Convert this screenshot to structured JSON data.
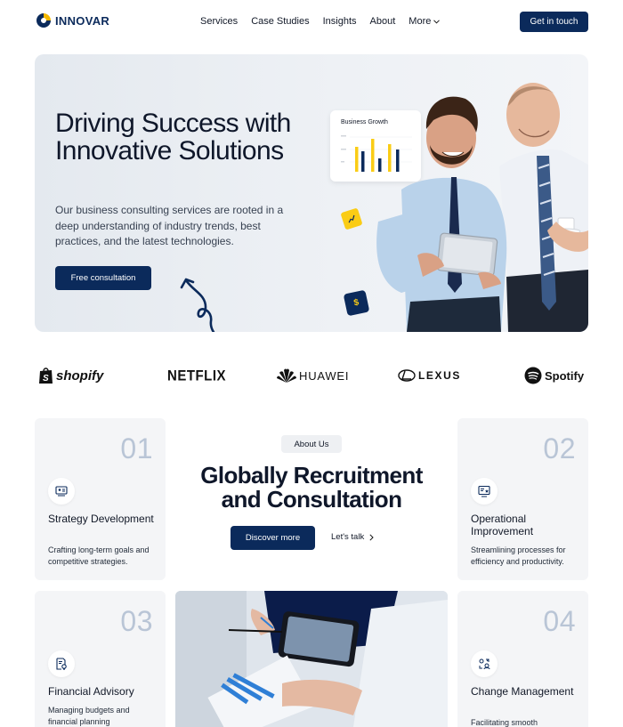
{
  "brand": {
    "name": "INNOVAR"
  },
  "nav": {
    "links": [
      "Services",
      "Case Studies",
      "Insights",
      "About",
      "More"
    ],
    "cta": "Get in touch"
  },
  "hero": {
    "title": "Driving Success with Innovative Solutions",
    "subtitle": "Our business consulting services are rooted in a deep understanding of industry trends, best practices, and the latest technologies.",
    "button": "Free consultation",
    "card_title": "Business Growth",
    "chip_symbol": "$"
  },
  "partners": [
    "shopify",
    "NETFLIX",
    "HUAWEI",
    "LEXUS",
    "Spotify"
  ],
  "about": {
    "pill": "About Us",
    "title": "Globally Recruitment and Consultation",
    "primary_button": "Discover more",
    "secondary_link": "Let's talk"
  },
  "services": [
    {
      "num": "01",
      "title": "Strategy Development",
      "desc": "Crafting long-term goals and competitive strategies.",
      "icon": "presentation-icon"
    },
    {
      "num": "02",
      "title": "Operational Improvement",
      "desc": "Streamlining processes for efficiency and productivity.",
      "icon": "board-star-icon"
    },
    {
      "num": "03",
      "title": "Financial Advisory",
      "desc": "Managing budgets and financial planning",
      "icon": "document-badge-icon"
    },
    {
      "num": "04",
      "title": "Change Management",
      "desc": "Facilitating smooth",
      "icon": "people-exchange-icon"
    }
  ],
  "colors": {
    "navy": "#0b2a5b",
    "accent": "#facc15",
    "card_bg": "#f4f5f7",
    "number": "#b9c5d6"
  }
}
